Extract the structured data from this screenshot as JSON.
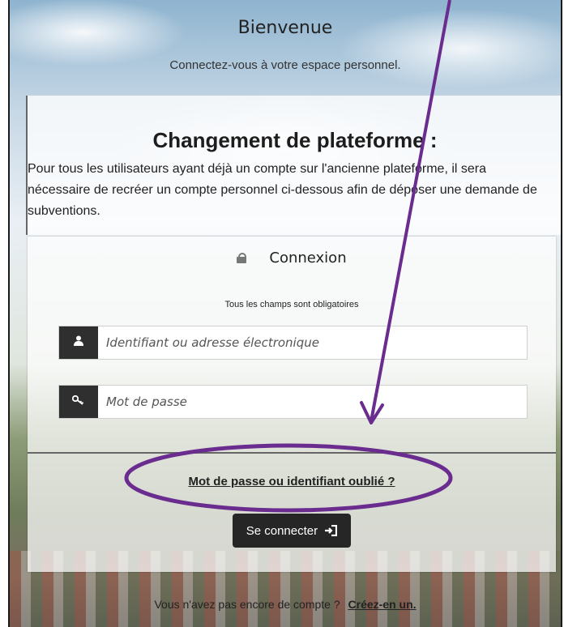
{
  "welcome": {
    "title": "Bienvenue",
    "subtitle": "Connectez-vous à votre espace personnel."
  },
  "notice": {
    "title": "Changement de plateforme :",
    "body": "Pour tous les utilisateurs ayant déjà un compte sur l'ancienne plateforme, il sera nécessaire de recréer un compte personnel ci-dessous afin de déposer une demande de subventions."
  },
  "login": {
    "heading": "Connexion",
    "required_note": "Tous les champs sont obligatoires",
    "username_placeholder": "Identifiant ou adresse électronique",
    "password_placeholder": "Mot de passe",
    "forgot_link": "Mot de passe ou identifiant oublié ?",
    "submit_label": "Se connecter",
    "submit_icon": "sign-in-icon"
  },
  "footer": {
    "text": "Vous n'avez pas encore de compte ?",
    "link": "Créez-en un."
  },
  "colors": {
    "annotation": "#6a2c8e",
    "button": "#262626",
    "addon": "#2f2f2f"
  }
}
